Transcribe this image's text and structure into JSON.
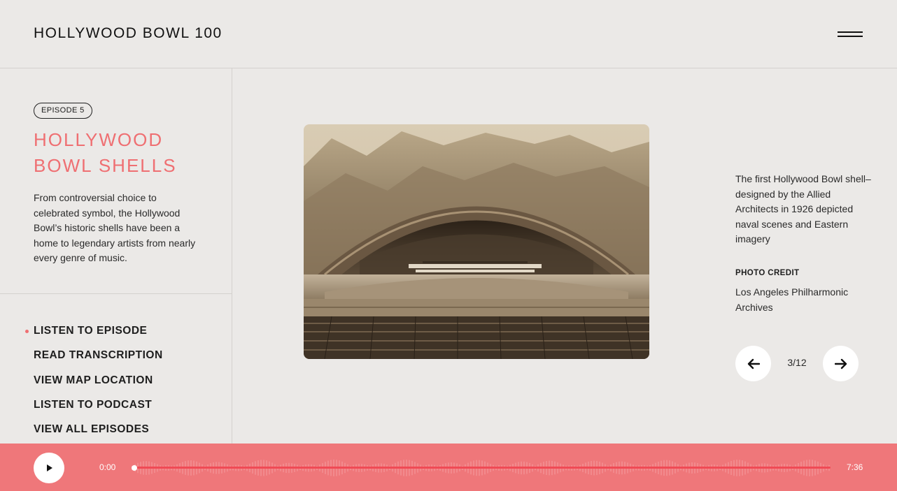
{
  "header": {
    "logo": "HOLLYWOOD BOWL 100",
    "menu_icon": "hamburger-icon"
  },
  "episode": {
    "badge": "EPISODE 5",
    "title": "HOLLYWOOD BOWL SHELLS",
    "description": "From controversial choice to celebrated symbol, the Hollywood Bowl’s historic shells have been a home to legendary artists from nearly every genre of music."
  },
  "nav": {
    "items": [
      {
        "label": "LISTEN TO EPISODE",
        "active": true
      },
      {
        "label": "READ TRANSCRIPTION",
        "active": false
      },
      {
        "label": "VIEW MAP LOCATION",
        "active": false
      },
      {
        "label": "LISTEN TO PODCAST",
        "active": false
      },
      {
        "label": "VIEW ALL EPISODES",
        "active": false
      }
    ]
  },
  "gallery": {
    "caption": "The first Hollywood Bowl shell–designed by the Allied Architects in 1926 depicted naval scenes and Eastern imagery",
    "credit_label": "PHOTO CREDIT",
    "credit_value": "Los Angeles Philharmonic Archives",
    "counter": "3/12",
    "prev_icon": "arrow-left-icon",
    "next_icon": "arrow-right-icon"
  },
  "player": {
    "current_time": "0:00",
    "duration": "7:36",
    "progress": 0,
    "play_icon": "play-icon"
  },
  "colors": {
    "background": "#ebe9e7",
    "accent": "#ef6f72",
    "player_bg": "#ef777a",
    "player_track": "#f04a55"
  }
}
